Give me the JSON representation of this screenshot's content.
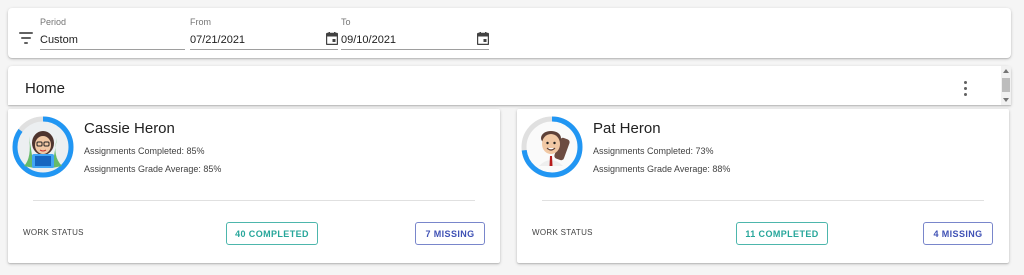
{
  "filters": {
    "period": {
      "label": "Period",
      "value": "Custom"
    },
    "from": {
      "label": "From",
      "value": "07/21/2021"
    },
    "to": {
      "label": "To",
      "value": "09/10/2021"
    }
  },
  "header": {
    "title": "Home"
  },
  "students": [
    {
      "name": "Cassie Heron",
      "assignments_completed": "Assignments Completed: 85%",
      "grade_average": "Assignments Grade Average: 85%",
      "progress": 0.85,
      "work_status_label": "WORK STATUS",
      "completed_label": "40 COMPLETED",
      "missing_label": "7 MISSING"
    },
    {
      "name": "Pat Heron",
      "assignments_completed": "Assignments Completed: 73%",
      "grade_average": "Assignments Grade Average: 88%",
      "progress": 0.73,
      "work_status_label": "WORK STATUS",
      "completed_label": "11 COMPLETED",
      "missing_label": "4 MISSING"
    }
  ],
  "colors": {
    "progress_ring": "#2196f3",
    "ring_track": "#e0e0e0",
    "completed": "#26a69a",
    "missing": "#3f51b5"
  }
}
